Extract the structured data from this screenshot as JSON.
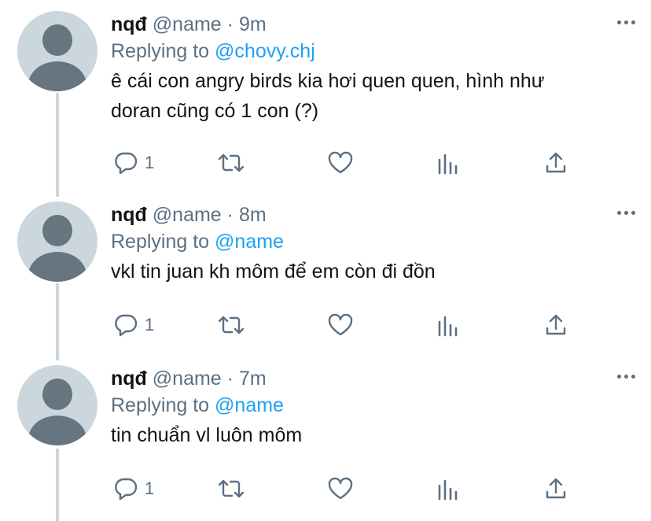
{
  "tweets": [
    {
      "display_name": "nqđ",
      "handle": "@name",
      "separator": "·",
      "time": "9m",
      "replying_prefix": "Replying to",
      "reply_to": "@chovy.chj",
      "text_line1": "ê cái con angry birds kia hơi quen quen, hình như",
      "text_line2": "doran cũng có 1 con (?)",
      "reply_count": "1"
    },
    {
      "display_name": "nqđ",
      "handle": "@name",
      "separator": "·",
      "time": "8m",
      "replying_prefix": "Replying to",
      "reply_to": "@name",
      "text_line1": "vkl tin juan kh môm để em còn đi đồn",
      "text_line2": "",
      "reply_count": "1"
    },
    {
      "display_name": "nqđ",
      "handle": "@name",
      "separator": "·",
      "time": "7m",
      "replying_prefix": "Replying to",
      "reply_to": "@name",
      "text_line1": "tin chuẩn vl luôn môm",
      "text_line2": "",
      "reply_count": "1"
    }
  ],
  "icons": {
    "reply": "reply-icon",
    "retweet": "retweet-icon",
    "like": "heart-icon",
    "analytics": "analytics-icon",
    "share": "share-icon",
    "more": "more-icon"
  },
  "colors": {
    "link": "#1da1f2",
    "secondary_text": "#5b7083",
    "primary_text": "#0f1419",
    "thread_line": "#ccd6dd"
  }
}
